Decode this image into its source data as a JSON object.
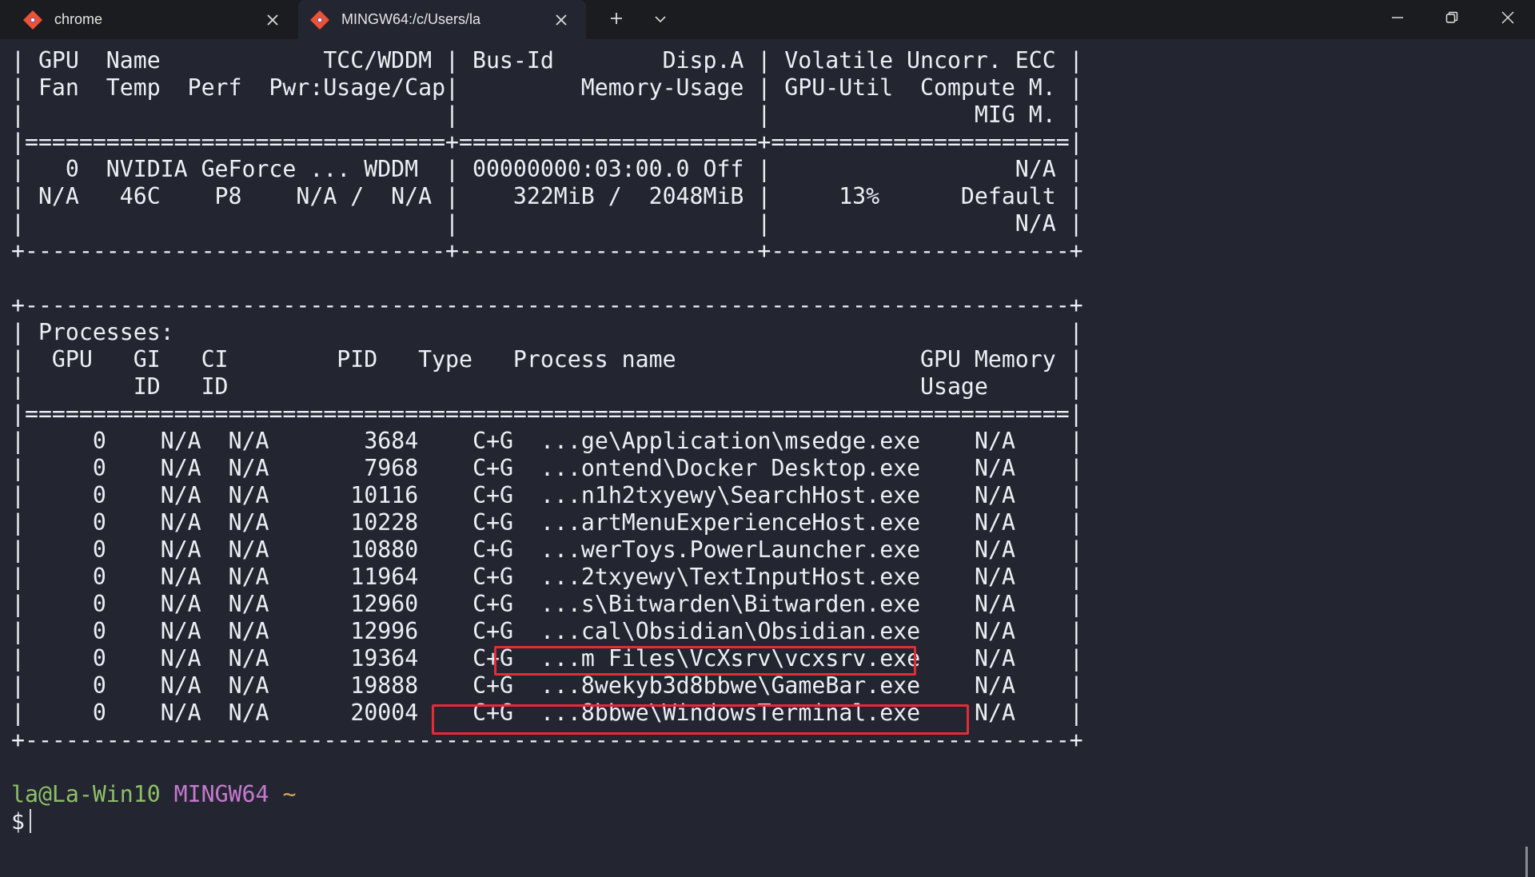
{
  "tabs": [
    {
      "title": "chrome",
      "icon": "git-bash-icon"
    },
    {
      "title": "MINGW64:/c/Users/la",
      "icon": "git-bash-icon"
    }
  ],
  "colors": {
    "accent_box": "#e52b36",
    "prompt_user": "#8fbf6a",
    "prompt_system": "#c779d0",
    "prompt_dir": "#d8a657"
  },
  "terminal": {
    "gpu_table": [
      "| GPU  Name            TCC/WDDM | Bus-Id        Disp.A | Volatile Uncorr. ECC |",
      "| Fan  Temp  Perf  Pwr:Usage/Cap|         Memory-Usage | GPU-Util  Compute M. |",
      "|                               |                      |               MIG M. |",
      "|===============================+======================+======================|",
      "|   0  NVIDIA GeForce ... WDDM  | 00000000:03:00.0 Off |                  N/A |",
      "| N/A   46C    P8    N/A /  N/A |    322MiB /  2048MiB |     13%      Default |",
      "|                               |                      |                  N/A |",
      "+-------------------------------+----------------------+----------------------+"
    ],
    "process_header": [
      "+-----------------------------------------------------------------------------+",
      "| Processes:                                                                  |",
      "|  GPU   GI   CI        PID   Type   Process name                  GPU Memory |",
      "|        ID   ID                                                   Usage      |",
      "|=============================================================================|"
    ],
    "processes": [
      {
        "gpu": "0",
        "gi": "N/A",
        "ci": "N/A",
        "pid": "3684",
        "type": "C+G",
        "name": "...ge\\Application\\msedge.exe",
        "mem": "N/A"
      },
      {
        "gpu": "0",
        "gi": "N/A",
        "ci": "N/A",
        "pid": "7968",
        "type": "C+G",
        "name": "...ontend\\Docker Desktop.exe",
        "mem": "N/A"
      },
      {
        "gpu": "0",
        "gi": "N/A",
        "ci": "N/A",
        "pid": "10116",
        "type": "C+G",
        "name": "...n1h2txyewy\\SearchHost.exe",
        "mem": "N/A"
      },
      {
        "gpu": "0",
        "gi": "N/A",
        "ci": "N/A",
        "pid": "10228",
        "type": "C+G",
        "name": "...artMenuExperienceHost.exe",
        "mem": "N/A"
      },
      {
        "gpu": "0",
        "gi": "N/A",
        "ci": "N/A",
        "pid": "10880",
        "type": "C+G",
        "name": "...werToys.PowerLauncher.exe",
        "mem": "N/A"
      },
      {
        "gpu": "0",
        "gi": "N/A",
        "ci": "N/A",
        "pid": "11964",
        "type": "C+G",
        "name": "...2txyewy\\TextInputHost.exe",
        "mem": "N/A"
      },
      {
        "gpu": "0",
        "gi": "N/A",
        "ci": "N/A",
        "pid": "12960",
        "type": "C+G",
        "name": "...s\\Bitwarden\\Bitwarden.exe",
        "mem": "N/A"
      },
      {
        "gpu": "0",
        "gi": "N/A",
        "ci": "N/A",
        "pid": "12996",
        "type": "C+G",
        "name": "...cal\\Obsidian\\Obsidian.exe",
        "mem": "N/A"
      },
      {
        "gpu": "0",
        "gi": "N/A",
        "ci": "N/A",
        "pid": "19364",
        "type": "C+G",
        "name": "...m Files\\VcXsrv\\vcxsrv.exe",
        "mem": "N/A"
      },
      {
        "gpu": "0",
        "gi": "N/A",
        "ci": "N/A",
        "pid": "19888",
        "type": "C+G",
        "name": "...8wekyb3d8bbwe\\GameBar.exe",
        "mem": "N/A"
      },
      {
        "gpu": "0",
        "gi": "N/A",
        "ci": "N/A",
        "pid": "20004",
        "type": "C+G",
        "name": "...8bbwe\\WindowsTerminal.exe",
        "mem": "N/A"
      }
    ],
    "process_footer": "+-----------------------------------------------------------------------------+",
    "prompt": {
      "user_host": "la@La-Win10",
      "system": "MINGW64",
      "dir": "~",
      "symbol": "$"
    }
  }
}
